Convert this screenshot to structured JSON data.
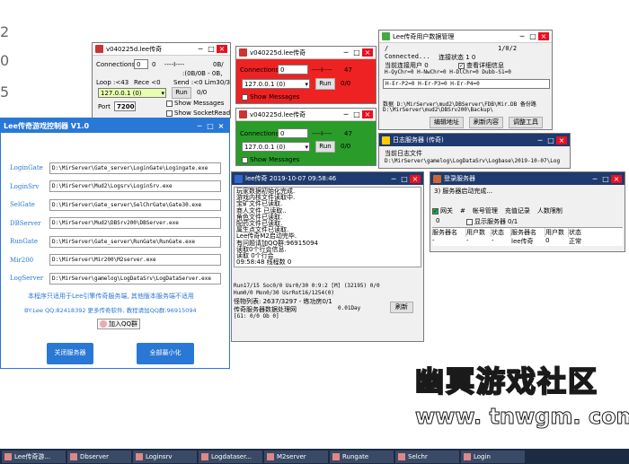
{
  "bg_chars": {
    "a": "2",
    "b": "0",
    "c": "5"
  },
  "w1": {
    "title": "v040225d.lee传奇",
    "connections_label": "Connections",
    "connections_value": "0",
    "status": "0",
    "dashes": "----I----",
    "right": "0B/",
    "loop": "Loop :<43",
    "rece": "Rece <0",
    "send": "Send :<0 Lim30/30",
    "bytes": ":(0B/0B - 0B,",
    "ip": "127.0.0.1 (0)",
    "run": "Run",
    "run_count": "0/0",
    "port_label": "Port",
    "port_value": "7200",
    "show_messages": "Show Messages",
    "show_socketread": "Show SocketRead"
  },
  "w2": {
    "title": "v040225d.lee传奇",
    "connections_label": "Connections",
    "connections_value": "0",
    "dashes": "----I----",
    "count": "47",
    "ip": "127.0.0.1 (0)",
    "run": "Run",
    "run_count": "0/0",
    "show_messages": "Show Messages"
  },
  "w3": {
    "title": "v040225d.lee传奇",
    "connections_label": "Connections",
    "connections_value": "0",
    "dashes": "----I----",
    "count": "47",
    "ip": "127.0.0.1 (0)",
    "run": "Run",
    "run_count": "0/0",
    "show_messages": "Show Messages"
  },
  "w4": {
    "title": "Lee传奇用户数据管理",
    "slash": "/",
    "page": "1/0/2",
    "connected": "Connected...",
    "link_status": "连接状态 1   0",
    "current_conn": "当前连接用户  0",
    "view_detail": "查看详细信息",
    "stats1": "H-QyChr=0  H-NwChr=0  H-DlChr=0  Dubb-S1=0",
    "stats2": "H-Er-P2=0  H-Er-P3=0  H-Er-P4=0",
    "path_line1": "数据 D:\\MirServer\\mud2\\DBServer\\FDB\\Mir.DB  备份路",
    "path_line2": "D:\\MirServer\\mud2\\DBSrv200\\Backup\\",
    "btn_edit": "编辑地址",
    "btn_refresh": "刷新内容",
    "btn_tools": "调整工具"
  },
  "w5": {
    "title": "日志服务器 (传奇)",
    "current_log": "当前日志文件",
    "path": "D:\\MirServer\\gamelog\\LogDataSrv\\Logbase\\2019-10-07\\Log"
  },
  "w6": {
    "title": "Lee传奇游戏控制器  V1.0",
    "rows": [
      {
        "label": "LoginGate",
        "path": "D:\\MirServer\\Gate_server\\LoginGate\\Logingate.exe"
      },
      {
        "label": "LoginSrv",
        "path": "D:\\MirServer\\Mud2\\Logsrv\\LoginSrv.exe"
      },
      {
        "label": "SelGate",
        "path": "D:\\MirServer\\Gate_server\\SelChrGate\\Gate30.exe"
      },
      {
        "label": "DBServer",
        "path": "D:\\MirServer\\Mud2\\DBSrv200\\DBServer.exe"
      },
      {
        "label": "RunGate",
        "path": "D:\\MirServer\\Gate_server\\RunGate\\RunGate.exe"
      },
      {
        "label": "Mir200",
        "path": "D:\\MirServer\\Mir200\\M2server.exe"
      },
      {
        "label": "LogServer",
        "path": "D:\\MirServer\\gamelog\\LogDataSrv\\LogDataServer.exe"
      }
    ],
    "notice": "本程序只适用于Lee引擎传奇服务端, 其他版本服务端不适用",
    "contact": "BY:Lee   QQ:82418392   更多传奇软件, 教程请加QQ群:96915094",
    "qq_group": "加入QQ群",
    "btn_close": "关闭服务器",
    "btn_minimize": "全部最小化",
    "accent": "#2a78d6"
  },
  "w7": {
    "title": "lee传奇 2019-10-07 09:58:46",
    "log": [
      "玩家数据初始化完成.",
      "游戏内核文件读取中.",
      "宝矿文件已读取.",
      "商人文件 已读取..",
      "角色文件已读取.",
      "配药文件已读取.",
      "属生点文件已读取.",
      "Lee传奇M2启动完毕.",
      "有问题请加QQ群:96915094",
      "读取0个行会信息.",
      "读取 0个行会",
      "09:58:48 线程数 0"
    ],
    "status1": "Run17/15 Soc0/0 Usr0/30  0:9:2 [M]         (32195)   0/0",
    "status2": "Hum0/0 Mon0/30 UsrRot16/1254(0)",
    "status3": "怪物列表: 2637/3297 - 练功房0/1",
    "status4": "传奇服务器数据处理网",
    "day": "0.01Day",
    "refresh": "刷新",
    "bottom": "[G1: 0/0 Ob 0]"
  },
  "w8": {
    "title": "登录服务器",
    "started": "3) 服务器启动完成...",
    "tab_gateway": "网关",
    "tab_hash": "#",
    "tab_account": "帐号管理",
    "tab_recharge": "充值记录",
    "tab_limit": "人数限制",
    "show_server": "显示服务器",
    "count": "0/1",
    "left_headers": [
      "服务器名",
      "用户数",
      "状态"
    ],
    "left_row": [
      "-",
      "-",
      "-"
    ],
    "right_headers": [
      "服务器名",
      "用户数",
      "状态"
    ],
    "right_row": [
      "lee传奇",
      "0",
      "正常"
    ],
    "zero": "0"
  },
  "banner": {
    "title": "幽冥游戏社区",
    "url": "www. tnwgm. com"
  },
  "taskbar": [
    "Lee传奇游...",
    "Dbserver",
    "Loginsrv",
    "Logdataser...",
    "M2server",
    "Rungate",
    "Selchr",
    "Login"
  ]
}
